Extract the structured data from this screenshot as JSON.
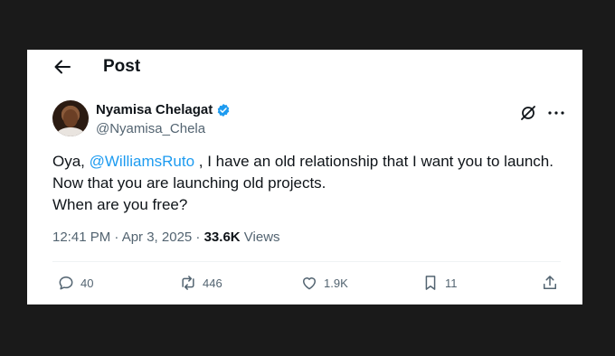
{
  "header": {
    "title": "Post"
  },
  "author": {
    "display_name": "Nyamisa Chelagat",
    "handle": "@Nyamisa_Chela"
  },
  "tweet": {
    "text_before": "Oya, ",
    "mention": "@WilliamsRuto",
    "text_after_line1": " , I have an old relationship that I want you to launch.",
    "line2": "Now that you are launching old projects.",
    "line3": "When are you free?"
  },
  "meta": {
    "timestamp": "12:41 PM · Apr 3, 2025 · ",
    "views_count": "33.6K",
    "views_label": " Views"
  },
  "actions": {
    "replies": "40",
    "reposts": "446",
    "likes": "1.9K",
    "bookmarks": "11"
  },
  "colors": {
    "accent": "#1d9bf0",
    "text": "#0f1419",
    "muted": "#536471"
  }
}
